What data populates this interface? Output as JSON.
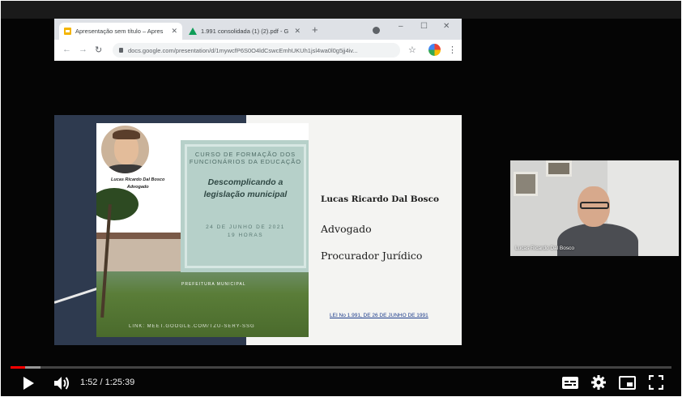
{
  "browser": {
    "tabs": [
      {
        "title": "Apresentação sem título – Apres",
        "active": true,
        "icon": "slides-icon"
      },
      {
        "title": "1.991 consolidada (1) (2).pdf - G",
        "active": false,
        "icon": "drive-icon"
      }
    ],
    "url": "docs.google.com/presentation/d/1mywcfP6S0O4ldCswcEmhUKUh1jsl4wa0l0g5jj4iv..."
  },
  "slide": {
    "photo_name_line1": "Lucas Ricardo Dal Bosco",
    "photo_name_line2": "Advogado",
    "course_title": "CURSO DE FORMAÇÃO DOS FUNCIONÁRIOS DA EDUCAÇÃO",
    "course_subtitle": "Descomplicando a legislação municipal",
    "course_date": "24 DE JUNHO DE 2021",
    "course_time": "19 HORAS",
    "photo_caption": "PREFEITURA MUNICIPAL",
    "link_text": "LINK: MEET.GOOGLE.COM/TZU-SERY-SSG",
    "presenter_name": "Lucas Ricardo Dal Bosco",
    "role_1": "Advogado",
    "role_2": "Procurador Jurídico",
    "law_link": "LEI No 1.991, DE 26 DE JUNHO DE 1991"
  },
  "webcam": {
    "participant_name": "Lucas Ricardo Dal Bosco"
  },
  "player": {
    "current_time": "1:52",
    "duration": "1:25:39",
    "time_display": "1:52 / 1:25:39",
    "progress_fraction": 0.0218,
    "buffered_fraction": 0.045,
    "progress_color": "#ff0000"
  }
}
